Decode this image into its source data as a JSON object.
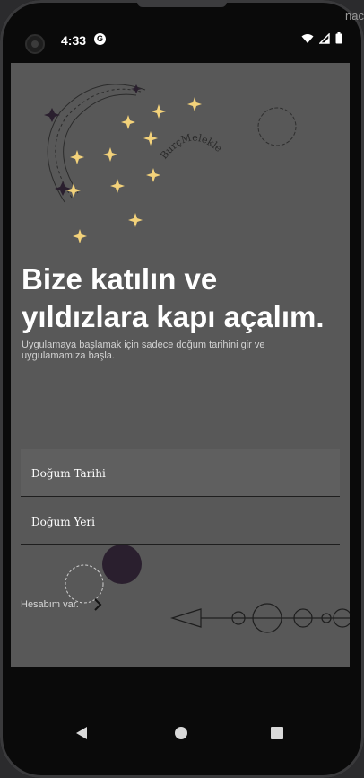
{
  "status_bar": {
    "time": "4:33",
    "app_badge": "G",
    "icons": [
      "wifi-icon",
      "cellular-signal-icon",
      "battery-icon"
    ]
  },
  "overflow_text": "nac",
  "brand": {
    "logo_text": "BurçMelekleri"
  },
  "onboarding": {
    "title_line1": "Bize katılın ve",
    "title_line2": "yıldızlara kapı açalım.",
    "subtitle": "Uygulamaya başlamak için sadece doğum tarihini gir ve uygulamamıza başla."
  },
  "form": {
    "birth_date_label": "Doğum Tarihi",
    "birth_place_label": "Doğum Yeri"
  },
  "account": {
    "have_account_label": "Hesabım var.",
    "arrow_icon": "chevron-right-icon"
  },
  "nav": {
    "back_icon": "back-triangle-icon",
    "home_icon": "home-circle-icon",
    "recents_icon": "recents-square-icon"
  },
  "colors": {
    "screen_bg": "#585858",
    "star": "#f3d27a",
    "deco_dark": "#2a1f2e"
  }
}
